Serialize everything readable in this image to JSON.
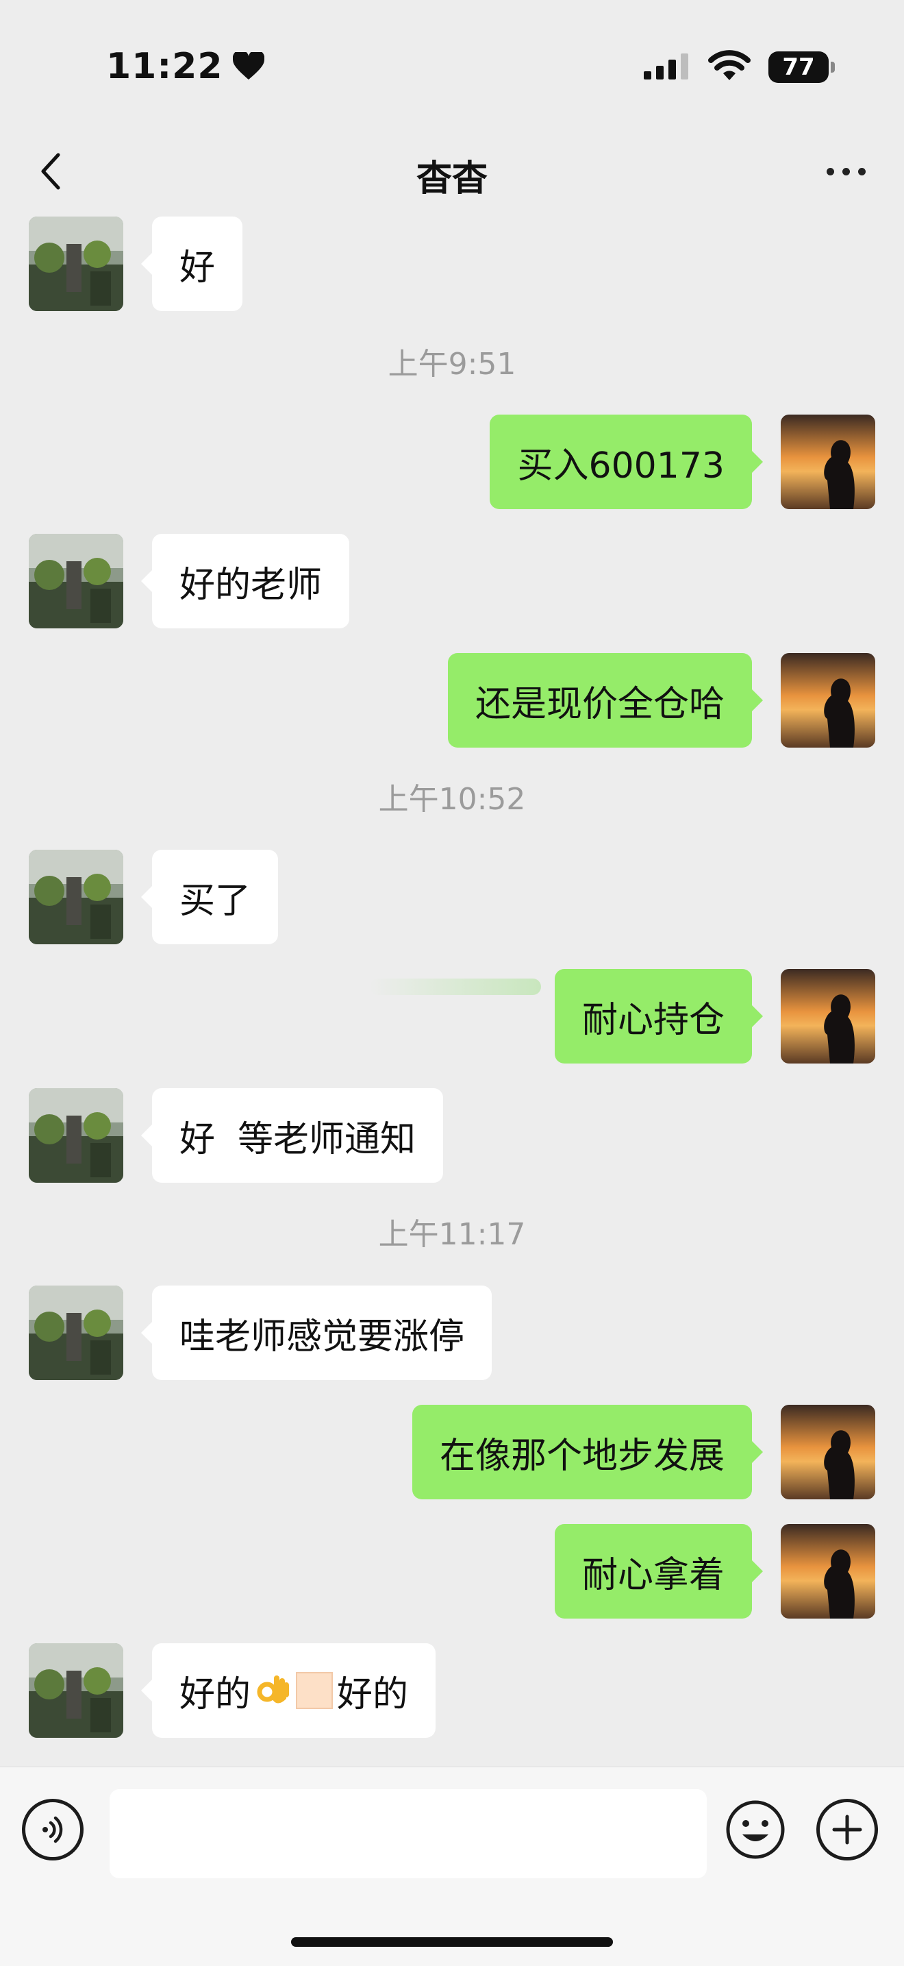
{
  "status_bar": {
    "time": "11:22",
    "battery": "77",
    "icons": [
      "heart-icon",
      "signal-icon",
      "wifi-icon",
      "battery-icon"
    ]
  },
  "nav": {
    "title": "杳杳",
    "icons": [
      "chevron-left-icon",
      "more-icon"
    ]
  },
  "messages": [
    {
      "side": "left",
      "text": "好"
    },
    {
      "timestamp": "上午9:51"
    },
    {
      "side": "right",
      "text": "买入600173"
    },
    {
      "side": "left",
      "text": "好的老师"
    },
    {
      "side": "right",
      "text": "还是现价全仓哈"
    },
    {
      "timestamp": "上午10:52"
    },
    {
      "side": "left",
      "text": "买了"
    },
    {
      "side": "right",
      "text": "耐心持仓"
    },
    {
      "side": "left",
      "text": "好  等老师通知"
    },
    {
      "timestamp": "上午11:17"
    },
    {
      "side": "left",
      "text": "哇老师感觉要涨停"
    },
    {
      "side": "right",
      "text": "在像那个地步发展"
    },
    {
      "side": "right",
      "text": "耐心拿着"
    },
    {
      "side": "left",
      "text_before": "好的",
      "emoji": "ok-hand",
      "text_after": "好的"
    }
  ],
  "input_bar": {
    "placeholder": "",
    "icons": [
      "voice-icon",
      "emoji-icon",
      "plus-icon"
    ]
  },
  "colors": {
    "background": "#ededed",
    "outgoing_bubble": "#95ec69",
    "incoming_bubble": "#ffffff",
    "timestamp_text": "#9b9b9b"
  }
}
